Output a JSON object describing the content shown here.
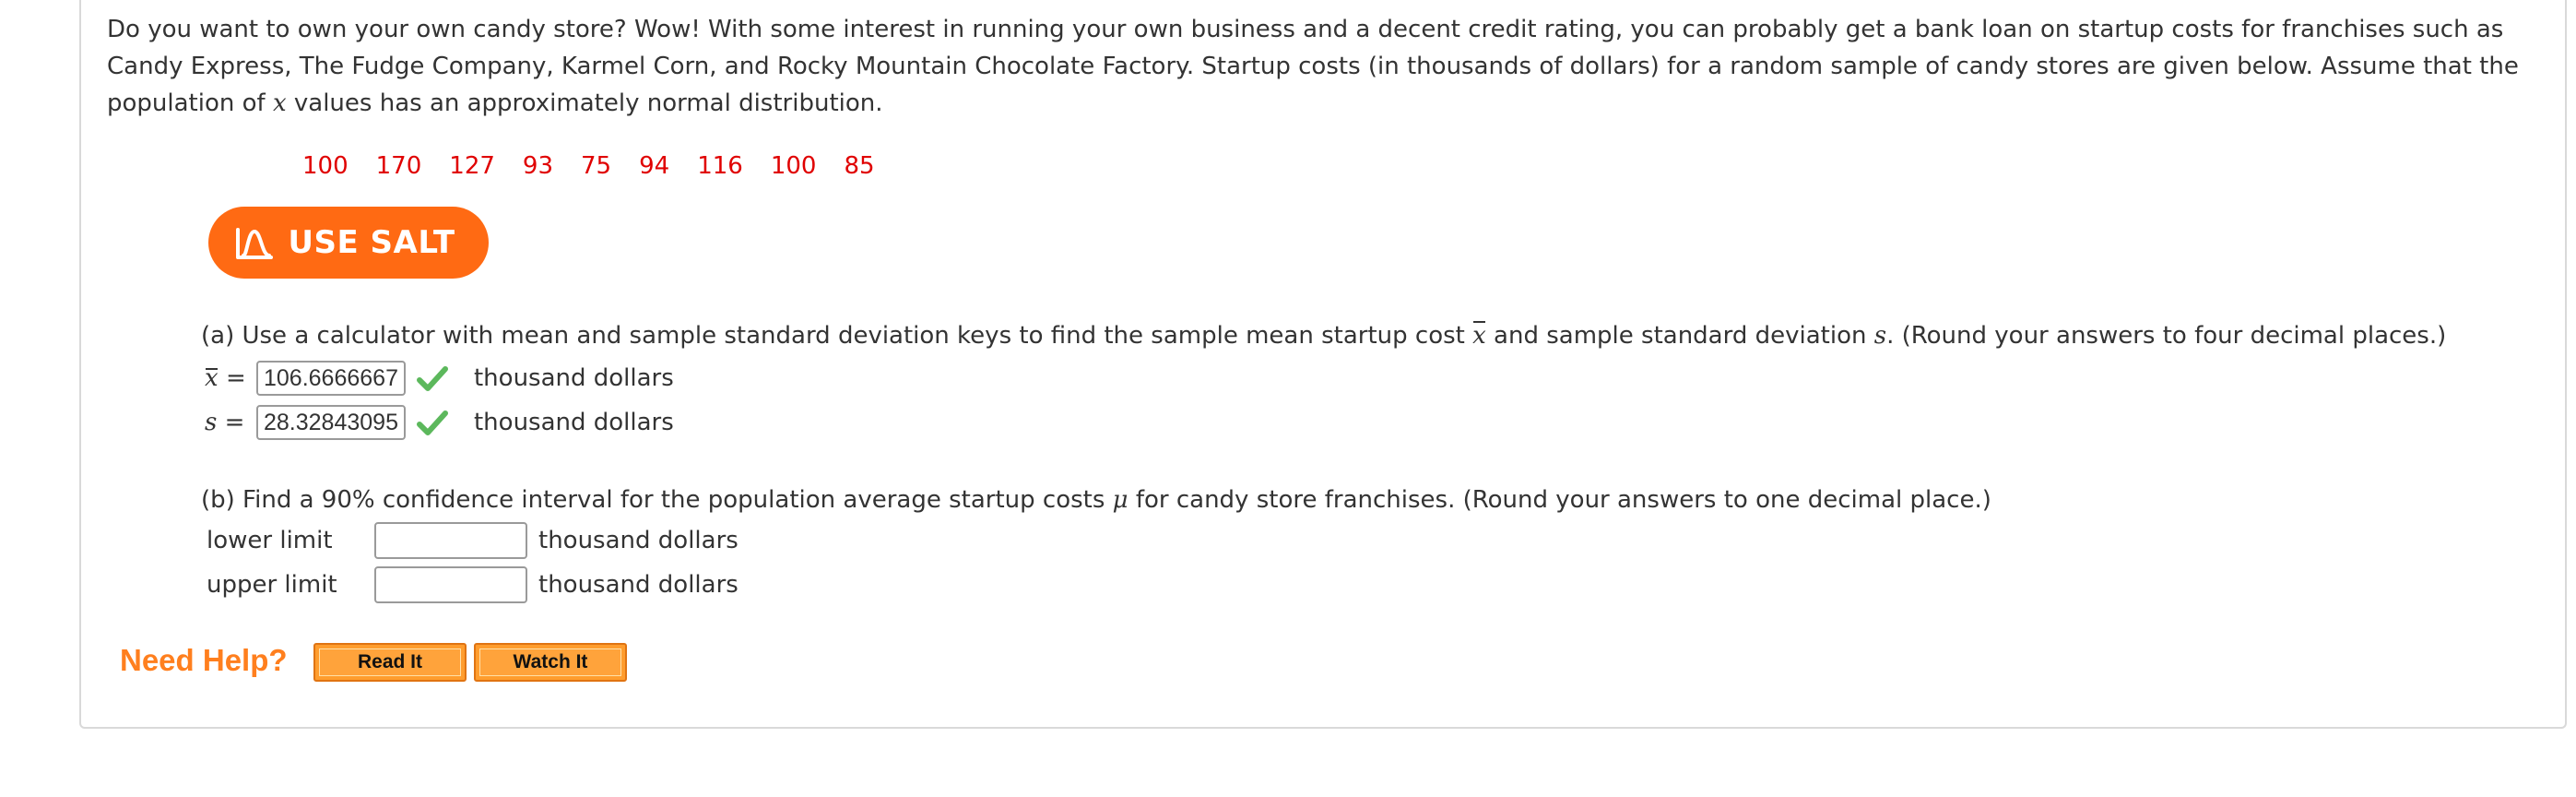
{
  "intro": {
    "part1": "Do you want to own your own candy store? Wow! With some interest in running your own business and a decent credit rating, you can probably get a bank loan on startup costs for franchises such as Candy Express, The Fudge Company, Karmel Corn, and Rocky Mountain Chocolate Factory. Startup costs (in thousands of dollars) for a random sample of candy stores are given below. Assume that the population of ",
    "var": "x",
    "part2": " values has an approximately normal distribution."
  },
  "data_values": [
    "100",
    "170",
    "127",
    "93",
    "75",
    "94",
    "116",
    "100",
    "85"
  ],
  "salt_button": {
    "label": "USE SALT",
    "icon": "salt-graph-icon"
  },
  "part_a": {
    "prompt_1": "(a) Use a calculator with mean and sample standard deviation keys to find the sample mean startup cost ",
    "xbar_symbol": "x",
    "prompt_2": " and sample standard deviation ",
    "s_symbol": "s",
    "prompt_3": ". (Round your answers to four decimal places.)",
    "mean": {
      "symbol": "x",
      "equals": "=",
      "value": "106.6666667",
      "unit": "thousand dollars",
      "status_icon": "check-icon"
    },
    "sd": {
      "symbol": "s",
      "equals": "=",
      "value": "28.32843095",
      "unit": "thousand dollars",
      "status_icon": "check-icon"
    }
  },
  "part_b": {
    "prompt_1": "(b) Find a 90% confidence interval for the population average startup costs ",
    "mu_symbol": "μ",
    "prompt_2": " for candy store franchises. (Round your answers to one decimal place.)",
    "lower": {
      "label": "lower limit",
      "value": "",
      "unit": "thousand dollars"
    },
    "upper": {
      "label": "upper limit",
      "value": "",
      "unit": "thousand dollars"
    }
  },
  "help": {
    "label": "Need Help?",
    "read_button": "Read It",
    "watch_button": "Watch It"
  },
  "colors": {
    "data_red": "#e00000",
    "salt_orange": "#ff6a13",
    "help_orange": "#ff7f1e",
    "check_green": "#5cb85c"
  }
}
